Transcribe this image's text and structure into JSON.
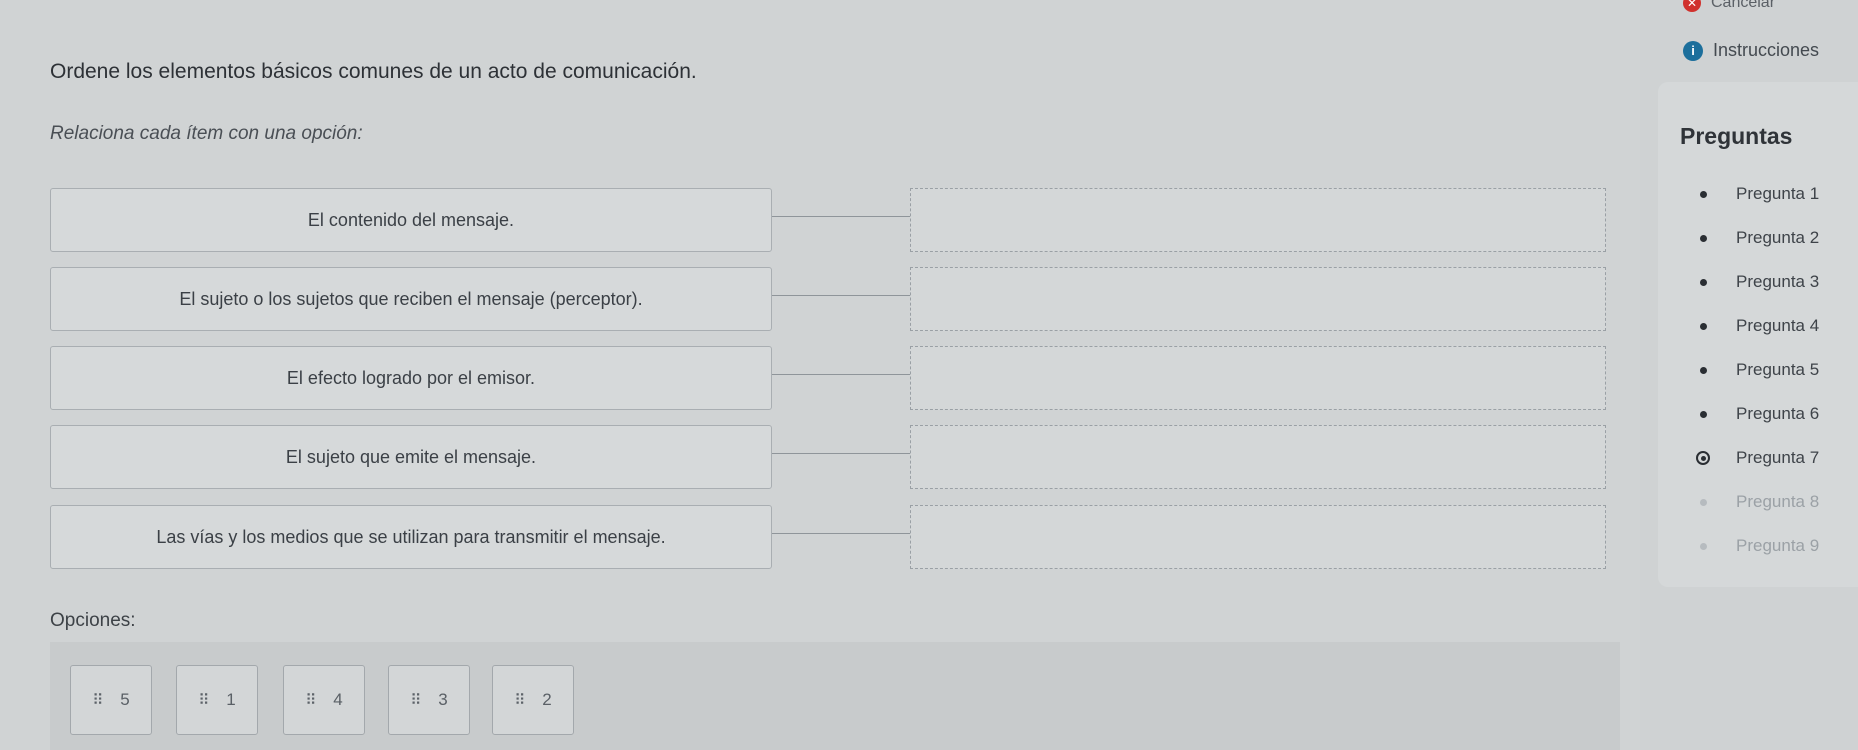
{
  "header": {
    "cancel_label": "Cancelar",
    "instructions_label": "Instrucciones"
  },
  "exercise": {
    "title": "Ordene los elementos básicos comunes de un acto de comunicación.",
    "subtitle": "Relaciona cada ítem con una opción:",
    "items": [
      {
        "text": "El contenido del mensaje."
      },
      {
        "text": "El sujeto o los sujetos que reciben el mensaje (perceptor)."
      },
      {
        "text": "El efecto logrado por el emisor."
      },
      {
        "text": "El sujeto que emite el mensaje."
      },
      {
        "text": "Las vías y los medios que se utilizan para transmitir el mensaje."
      }
    ]
  },
  "options": {
    "label": "Opciones:",
    "chips": [
      "5",
      "1",
      "4",
      "3",
      "2"
    ]
  },
  "panel": {
    "title": "Preguntas",
    "questions": [
      {
        "label": "Pregunta 1",
        "state": "answered"
      },
      {
        "label": "Pregunta 2",
        "state": "answered"
      },
      {
        "label": "Pregunta 3",
        "state": "answered"
      },
      {
        "label": "Pregunta 4",
        "state": "answered"
      },
      {
        "label": "Pregunta 5",
        "state": "answered"
      },
      {
        "label": "Pregunta 6",
        "state": "answered"
      },
      {
        "label": "Pregunta 7",
        "state": "current"
      },
      {
        "label": "Pregunta 8",
        "state": "pending"
      },
      {
        "label": "Pregunta 9",
        "state": "pending"
      }
    ]
  },
  "colors": {
    "cancel_icon": "#d0312d",
    "info_icon": "#1c6f9c"
  }
}
